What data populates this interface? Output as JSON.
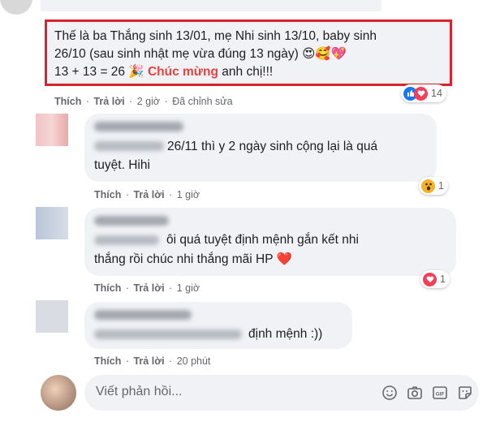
{
  "main_comment": {
    "line1": "Thế là ba Thắng sinh 13/01, mẹ Nhi sinh 13/10, baby sinh",
    "line2": "26/10 (sau sinh nhật mẹ vừa đúng 13 ngày) 😍🥰💖",
    "line3_pre": "13 + 13 = 26 🎉 ",
    "line3_highlight": "Chúc mừng",
    "line3_post": " anh chị!!!",
    "like": "Thích",
    "reply": "Trả lời",
    "time": "2 giờ",
    "edited": "Đã chỉnh sửa",
    "reaction_count": "14"
  },
  "replies": [
    {
      "text_line1": "26/11 thì y 2 ngày sinh cộng lại là quá",
      "text_line2": "tuyệt. Hihi",
      "like": "Thích",
      "reply": "Trả lời",
      "time": "1 giờ",
      "reaction_count": "1",
      "reaction": "wow"
    },
    {
      "text_line1": "ôi quá tuyệt định mệnh gắn kết nhi",
      "text_line2": "thắng rồi chúc nhi thắng mãi HP ❤️",
      "like": "Thích",
      "reply": "Trả lời",
      "time": "1 giờ",
      "reaction_count": "1",
      "reaction": "love"
    },
    {
      "text_line1": "định mệnh :))",
      "like": "Thích",
      "reply": "Trả lời",
      "time": "20 phút"
    }
  ],
  "composer": {
    "placeholder": "Viết phản hồi...",
    "icons": [
      "emoji-icon",
      "camera-icon",
      "gif-icon",
      "sticker-icon"
    ]
  },
  "colors": {
    "highlight_border": "#d8232a",
    "highlight_text": "#e8423f",
    "bubble": "#f0f2f5",
    "meta_text": "#65676b"
  }
}
